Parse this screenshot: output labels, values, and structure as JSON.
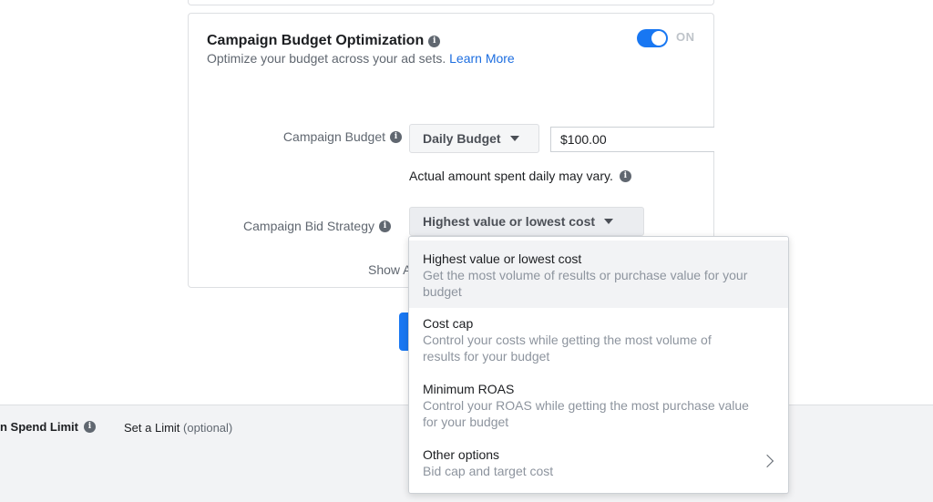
{
  "cbo": {
    "title": "Campaign Budget Optimization",
    "subtitle": "Optimize your budget across your ad sets.",
    "learn_more": "Learn More",
    "toggle_label": "ON",
    "toggle_on": true
  },
  "budget": {
    "label": "Campaign Budget",
    "type_label": "Daily Budget",
    "amount": "$100.00",
    "note": "Actual amount spent daily may vary."
  },
  "bid": {
    "label": "Campaign Bid Strategy",
    "selected": "Highest value or lowest cost"
  },
  "show_more": "Show A",
  "dropdown": {
    "options": [
      {
        "title": "Highest value or lowest cost",
        "description": "Get the most volume of results or purchase value for your budget"
      },
      {
        "title": "Cost cap",
        "description": "Control your costs while getting the most volume of results for your budget"
      },
      {
        "title": "Minimum ROAS",
        "description": "Control your ROAS while getting the most purchase value for your budget"
      },
      {
        "title": "Other options",
        "description": "Bid cap and target cost"
      }
    ]
  },
  "spend_limit": {
    "label": "n Spend Limit",
    "link": "Set a Limit",
    "optional": "(optional)"
  },
  "icons": {
    "info": "info-icon",
    "caret": "caret-down-icon",
    "chevron": "chevron-right-icon"
  },
  "colors": {
    "accent": "#1877f2",
    "link": "#1d6ee0"
  }
}
